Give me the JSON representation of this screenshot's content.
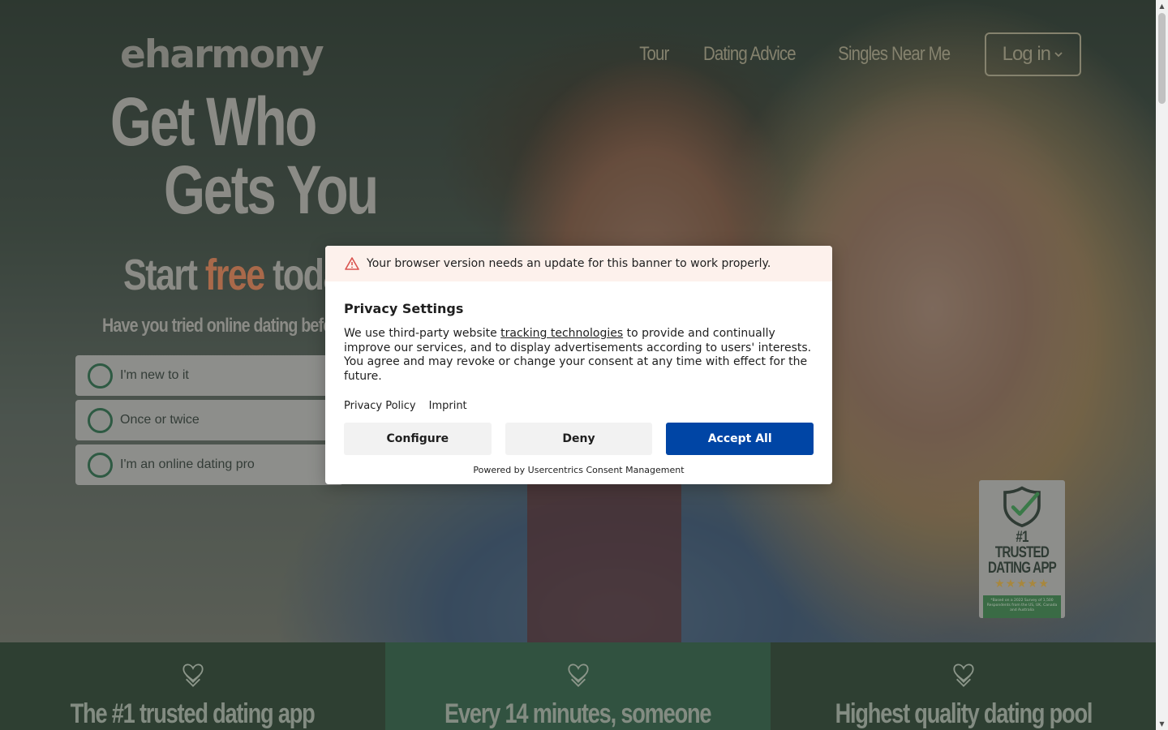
{
  "header": {
    "logo": "eharmony",
    "nav": [
      "Tour",
      "Dating Advice",
      "Singles Near Me"
    ],
    "login_label": "Log in"
  },
  "hero": {
    "headline_line1": "Get Who",
    "headline_line2": "Gets You",
    "start_prefix": "Start ",
    "start_free": "free",
    "start_suffix": " today",
    "question": "Have you tried online dating before?",
    "options": [
      "I'm new to it",
      "Once or twice",
      "I'm an online dating pro"
    ]
  },
  "badge": {
    "title_line1": "#1 TRUSTED",
    "title_line2": "DATING APP",
    "stars": "★★★★★",
    "note": "*Based on a 2022 Survey of 1,500 Respondents from the US, UK, Canada and Australia"
  },
  "features": [
    {
      "title": "The #1 trusted dating app"
    },
    {
      "title": "Every 14 minutes, someone"
    },
    {
      "title": "Highest quality dating pool"
    }
  ],
  "consent": {
    "warning": "Your browser version needs an update for this banner to work properly.",
    "title": "Privacy Settings",
    "text_before": "We use third-party website ",
    "text_link": "tracking technologies",
    "text_after": " to provide and continually improve our services, and to display advertisements according to users' interests. You agree and may revoke or change your consent at any time with effect for the future.",
    "links": [
      "Privacy Policy",
      "Imprint"
    ],
    "buttons": {
      "configure": "Configure",
      "deny": "Deny",
      "accept": "Accept All"
    },
    "powered": "Powered by Usercentrics Consent Management"
  },
  "colors": {
    "accept_button": "#0045a5",
    "feature_dark": "#2e3f32",
    "feature_mid": "#315240",
    "free_accent": "#a9694a"
  },
  "icons": [
    "chevron-down-icon",
    "shield-check-icon",
    "warning-icon",
    "heart-icon",
    "scroll-up-icon",
    "scroll-down-icon"
  ]
}
